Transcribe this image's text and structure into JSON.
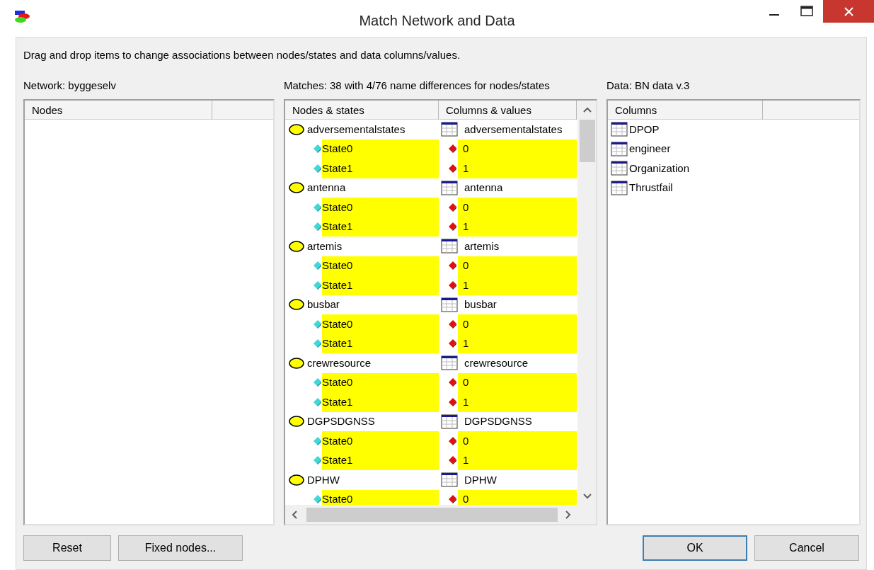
{
  "window": {
    "title": "Match Network and Data"
  },
  "instruction": "Drag and drop items to change associations between nodes/states and data columns/values.",
  "network_panel": {
    "label": "Network: byggeselv",
    "columns": [
      "Nodes"
    ]
  },
  "matches_panel": {
    "label": "Matches: 38 with 4/76 name differences for nodes/states",
    "columns": [
      "Nodes & states",
      "Columns & values"
    ],
    "rows": [
      {
        "node": "adversementalstates",
        "column": "adversementalstates",
        "states": [
          {
            "state": "State0",
            "value": "0",
            "highlighted": true
          },
          {
            "state": "State1",
            "value": "1",
            "highlighted": true
          }
        ]
      },
      {
        "node": "antenna",
        "column": "antenna",
        "states": [
          {
            "state": "State0",
            "value": "0",
            "highlighted": true
          },
          {
            "state": "State1",
            "value": "1",
            "highlighted": true
          }
        ]
      },
      {
        "node": "artemis",
        "column": "artemis",
        "states": [
          {
            "state": "State0",
            "value": "0",
            "highlighted": true
          },
          {
            "state": "State1",
            "value": "1",
            "highlighted": true
          }
        ]
      },
      {
        "node": "busbar",
        "column": "busbar",
        "states": [
          {
            "state": "State0",
            "value": "0",
            "highlighted": true
          },
          {
            "state": "State1",
            "value": "1",
            "highlighted": true
          }
        ]
      },
      {
        "node": "crewresource",
        "column": "crewresource",
        "states": [
          {
            "state": "State0",
            "value": "0",
            "highlighted": true
          },
          {
            "state": "State1",
            "value": "1",
            "highlighted": true
          }
        ]
      },
      {
        "node": "DGPSDGNSS",
        "column": "DGPSDGNSS",
        "states": [
          {
            "state": "State0",
            "value": "0",
            "highlighted": true
          },
          {
            "state": "State1",
            "value": "1",
            "highlighted": true
          }
        ]
      },
      {
        "node": "DPHW",
        "column": "DPHW",
        "states": [
          {
            "state": "State0",
            "value": "0",
            "highlighted": true
          }
        ]
      }
    ]
  },
  "data_panel": {
    "label": "Data: BN data v.3",
    "columns": [
      "Columns"
    ],
    "items": [
      "DPOP",
      "engineer",
      "Organization",
      "Thrustfail"
    ]
  },
  "buttons_left": [
    "Reset",
    "Fixed nodes..."
  ],
  "buttons_right": [
    "OK",
    "Cancel"
  ]
}
